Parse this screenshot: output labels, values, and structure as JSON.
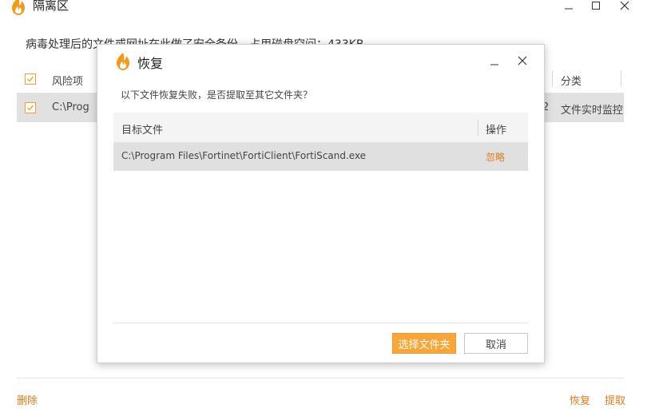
{
  "window": {
    "title": "隔离区",
    "info": "病毒处理后的文件或网址在此做了安全备份，占用磁盘空间：433KB"
  },
  "table": {
    "headers": [
      "风险项",
      "分类"
    ],
    "rows": [
      {
        "path": "C:\\Prog",
        "count": "2",
        "category": "文件实时监控",
        "checked": true
      }
    ]
  },
  "footer": {
    "delete_label": "删除",
    "restore_label": "恢复",
    "extract_label": "提取"
  },
  "dialog": {
    "title": "恢复",
    "message": "以下文件恢复失败，是否提取至其它文件夹？",
    "columns": [
      "目标文件",
      "操作"
    ],
    "rows": [
      {
        "file": "C:\\Program Files\\Fortinet\\FortiClient\\FortiScand.exe",
        "action": "忽略"
      }
    ],
    "primary_button": "选择文件夹",
    "cancel_button": "取消"
  },
  "colors": {
    "accent": "#f8a53a",
    "link": "#e07b1c",
    "checkbox": "#f0a030"
  }
}
